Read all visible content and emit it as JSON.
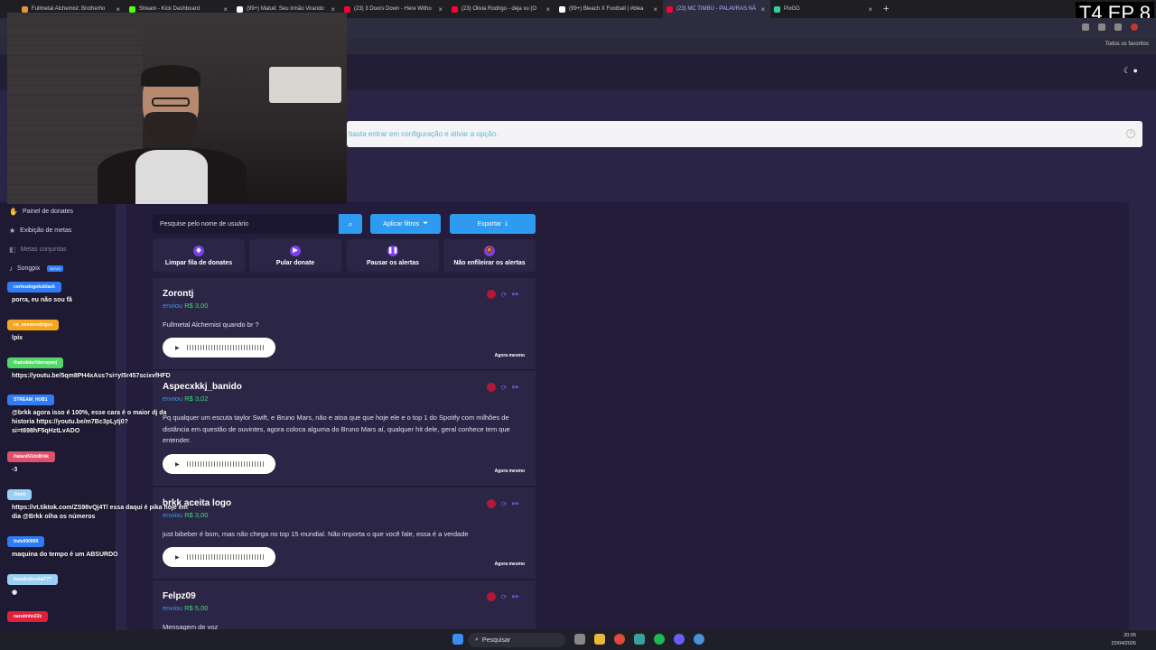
{
  "browser": {
    "tabs": [
      {
        "label": "Fullmetal Alchemist: Brotherho",
        "color": "#e8913a"
      },
      {
        "label": "Stream - Kick Dashboard",
        "color": "#53fc18"
      },
      {
        "label": "(99+) Matuê: Seu Irmão Virando",
        "color": "#ffffff"
      },
      {
        "label": "(23) 3 Doors Down - Here Witho",
        "color": "#ff0033"
      },
      {
        "label": "(23) Olivia Rodrigo - deja vu (O",
        "color": "#ff0033"
      },
      {
        "label": "(99+) Bleach X Football | #blea",
        "color": "#ffffff"
      },
      {
        "label": "(23) MC TIMBU - PALAVRAS NÃ",
        "color": "#ff0033"
      },
      {
        "label": "PixGG",
        "color": "#2fd0a0"
      }
    ],
    "bookmarks_all": "Todos os favoritos"
  },
  "overlay_label": "T4 EP 8",
  "notice": {
    "text": "basta entrar em configuração e ativar a opção."
  },
  "sidebar": {
    "items": [
      {
        "label": "Painel de donates"
      },
      {
        "label": "Exibição de metas"
      },
      {
        "label": "Metas conjuntas"
      },
      {
        "label": "Songpix",
        "badge": "NOVO"
      }
    ]
  },
  "toolbar": {
    "search_placeholder": "Pesquise pelo nome de usuário",
    "filters_label": "Aplicar filtros",
    "export_label": "Exportar"
  },
  "actions": [
    {
      "label": "Limpar fila de donates"
    },
    {
      "label": "Pular donate"
    },
    {
      "label": "Pausar os alertas"
    },
    {
      "label": "Não enfileirar os alertas"
    }
  ],
  "donations": [
    {
      "user": "Zorontj",
      "sent_prefix": "enviou",
      "amount": "R$ 3,00",
      "message": "Fullmetal Alchemist quando br ?",
      "time": "Agora mesmo"
    },
    {
      "user": "Aspecxkkj_banido",
      "sent_prefix": "enviou",
      "amount": "R$ 3,02",
      "message": "Pq qualquer um escuta taylor Swift, e Bruno Mars, não e atoa que que hoje ele e o top 1 do Spotify com milhões de distância em questão de ouvintes, agora coloca alguma do Bruno Mars aí, qualquer hit dele, geral conhece tem que entender.",
      "time": "Agora mesmo"
    },
    {
      "user": "brkk aceita logo",
      "sent_prefix": "enviou",
      "amount": "R$ 3,00",
      "message": "just bibeber é bom, mas não chega no top 15 mundial. Não importa o que você fale, essa é a verdade",
      "time": "Agora mesmo"
    },
    {
      "user": "Felpz09",
      "sent_prefix": "enviou",
      "amount": "R$ 5,00",
      "message": "Mensagem de voz",
      "time": ""
    }
  ],
  "chat": [
    {
      "user": "cortesdogokublack",
      "color": "#2f7cf6",
      "text": "porra, eu não sou fã"
    },
    {
      "user": "eu_oessorodrigue",
      "color": "#f5a623",
      "text": "lpix"
    },
    {
      "user": "thatsdalurfdmrayanj",
      "color": "#53d769",
      "text": "https://youtu.be/5qm8PH4xAss?si=yI5r457scixvfHFD"
    },
    {
      "user": "STREAM_HUB1",
      "color": "#2f7cf6",
      "text": "@brkk agora isso é 100%, esse cara é o maior dj da historia https://youtu.be/m7Bc3pLyIj0?si=t698hF5qHztLvADO"
    },
    {
      "user": "HataniN1doBrkk",
      "color": "#e0506b",
      "text": "-3"
    },
    {
      "user": "Jrock",
      "color": "#9ad0f5",
      "text": "https://vt.tiktok.com/ZS98vQj4T/ essa daqui é pika hoje em dia @Brkk olha os números"
    },
    {
      "user": "fndv000999",
      "color": "#2f7cf6",
      "text": "maquina do tempo é um ABSURDO"
    },
    {
      "user": "leandrofrontal777",
      "color": "#9ad0f5",
      "text": ""
    },
    {
      "user": "narutinho22c",
      "color": "#e0203a",
      "text": ""
    }
  ],
  "taskbar": {
    "search_label": "Pesquisar",
    "time": "20:05",
    "date": "22/04/2026"
  }
}
